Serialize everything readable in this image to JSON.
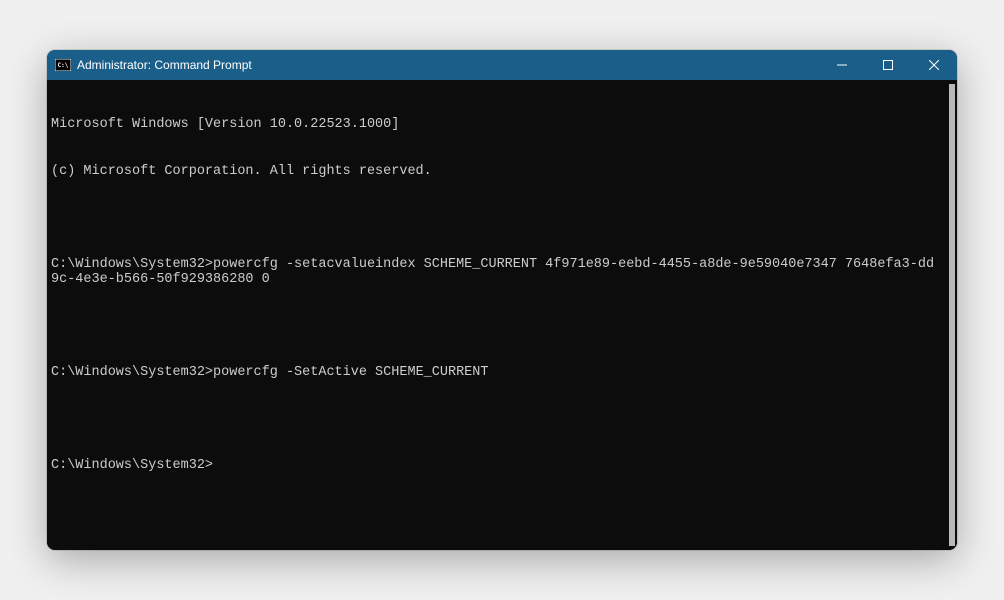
{
  "titlebar": {
    "title": "Administrator: Command Prompt"
  },
  "terminal": {
    "line1": "Microsoft Windows [Version 10.0.22523.1000]",
    "line2": "(c) Microsoft Corporation. All rights reserved.",
    "prompt1": "C:\\Windows\\System32>",
    "cmd1": "powercfg -setacvalueindex SCHEME_CURRENT 4f971e89-eebd-4455-a8de-9e59040e7347 7648efa3-dd9c-4e3e-b566-50f929386280 0",
    "prompt2": "C:\\Windows\\System32>",
    "cmd2": "powercfg -SetActive SCHEME_CURRENT",
    "prompt3": "C:\\Windows\\System32>"
  },
  "icons": {
    "titlebar": "cmd-icon",
    "minimize": "minimize-icon",
    "maximize": "maximize-icon",
    "close": "close-icon"
  }
}
